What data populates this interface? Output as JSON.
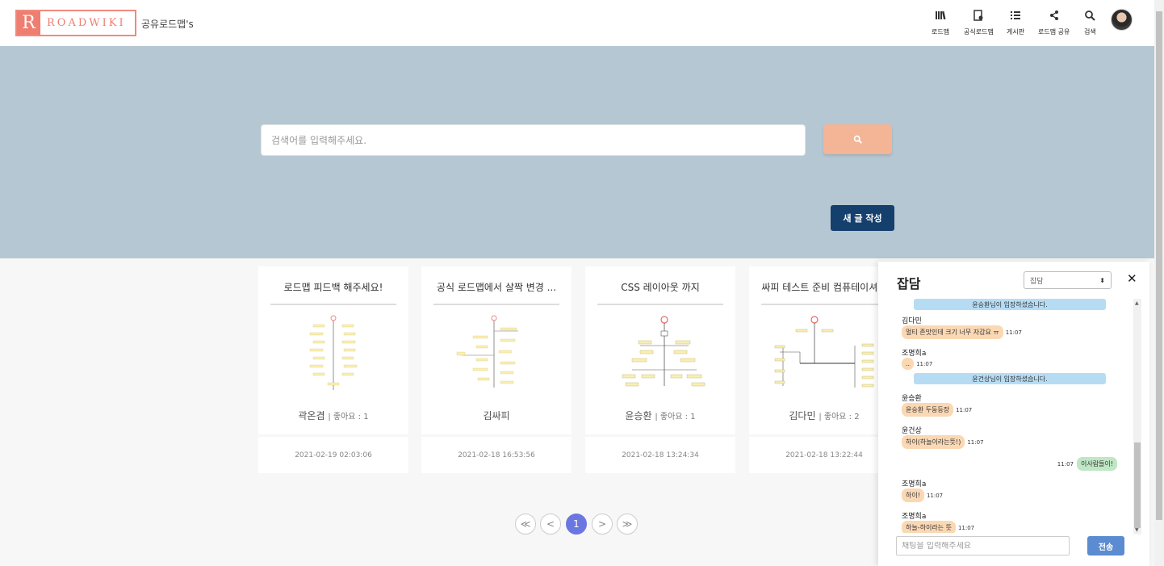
{
  "header": {
    "logo_letter": "R",
    "logo_text": "ROADWIKI",
    "subtitle": "공유로드맵's",
    "nav": [
      {
        "label": "로드맵",
        "icon": "library-icon"
      },
      {
        "label": "공식로드맵",
        "icon": "official-doc-icon"
      },
      {
        "label": "게시판",
        "icon": "list-icon"
      },
      {
        "label": "로드맵 공유",
        "icon": "share-icon"
      },
      {
        "label": "검색",
        "icon": "search-icon"
      }
    ]
  },
  "hero": {
    "search_placeholder": "검색어를 입력해주세요.",
    "write_button": "새 글 작성"
  },
  "cards": [
    {
      "title": "로드맵 피드백 해주세요!",
      "author": "곽온겸",
      "likes": "| 좋아요 : 1",
      "date": "2021-02-19 02:03:06"
    },
    {
      "title": "공식 로드맵에서 살짝 변경 ...",
      "author": "김싸피",
      "likes": "",
      "date": "2021-02-18 16:53:56"
    },
    {
      "title": "CSS 레이아웃 까지",
      "author": "윤승환",
      "likes": "| 좋아요 : 1",
      "date": "2021-02-18 13:24:34"
    },
    {
      "title": "싸피 테스트 준비 컴퓨테이셔...",
      "author": "김다민",
      "likes": "| 좋아요 : 2",
      "date": "2021-02-18 13:22:44"
    }
  ],
  "pagination": {
    "first": "≪",
    "prev": "<",
    "current": "1",
    "next": ">",
    "last": "≫"
  },
  "chat": {
    "title": "잡담",
    "channel": "잡담",
    "close": "✕",
    "messages": [
      {
        "type": "system",
        "text": "윤승환님이 입장하셨습니다."
      },
      {
        "type": "other",
        "name": "김다민",
        "text": "멀티 존맛인데 크기 너무 자감요 ㅠ",
        "time": "11:07"
      },
      {
        "type": "other",
        "name": "조명희a",
        "text": "..",
        "time": "11:07"
      },
      {
        "type": "system",
        "text": "윤건상님이 입장하셨습니다."
      },
      {
        "type": "other",
        "name": "윤승환",
        "text": "윤승환 두둥등장",
        "time": "11:07"
      },
      {
        "type": "other",
        "name": "윤건상",
        "text": "하이(하늘이라는뜻!)",
        "time": "11:07"
      },
      {
        "type": "mine",
        "text": "이사람들이!",
        "time": "11:07"
      },
      {
        "type": "other",
        "name": "조명희a",
        "text": "하이!",
        "time": "11:07"
      },
      {
        "type": "other",
        "name": "조명희a",
        "text": "하늘-하이라는 뜻",
        "time": "11:07"
      }
    ],
    "input_placeholder": "채팅을 입력해주세요",
    "send": "전송"
  }
}
